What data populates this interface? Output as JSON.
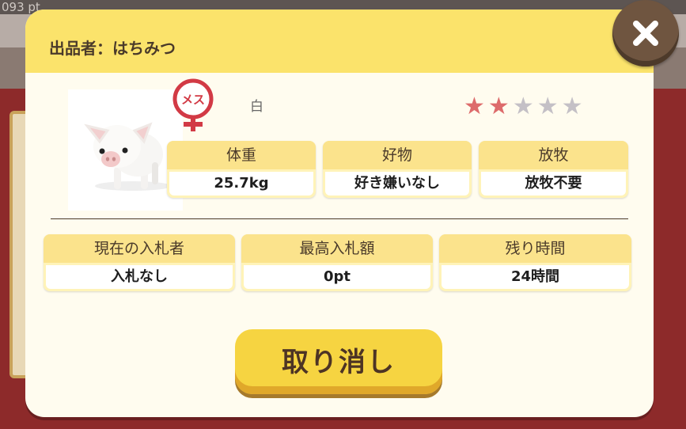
{
  "background": {
    "points_text": "093 pt"
  },
  "modal": {
    "seller_label": "出品者：はちみつ",
    "close_icon": "close-icon"
  },
  "animal": {
    "sex_label": "メス",
    "sex_icon": "female-symbol-icon",
    "color": "白",
    "rating": 2,
    "rating_max": 5,
    "image": "pig-image"
  },
  "stats": [
    {
      "label": "体重",
      "value": "25.7kg"
    },
    {
      "label": "好物",
      "value": "好き嫌いなし"
    },
    {
      "label": "放牧",
      "value": "放牧不要"
    }
  ],
  "auction": [
    {
      "label": "現在の入札者",
      "value": "入札なし"
    },
    {
      "label": "最高入札額",
      "value": "0pt"
    },
    {
      "label": "残り時間",
      "value": "24時間"
    }
  ],
  "cancel_button": {
    "label": "取り消し"
  },
  "colors": {
    "header": "#fbe36b",
    "star_on": "#dd6b6b",
    "star_off": "#c4c0c6",
    "button": "#f6d441",
    "female": "#d23a45"
  }
}
